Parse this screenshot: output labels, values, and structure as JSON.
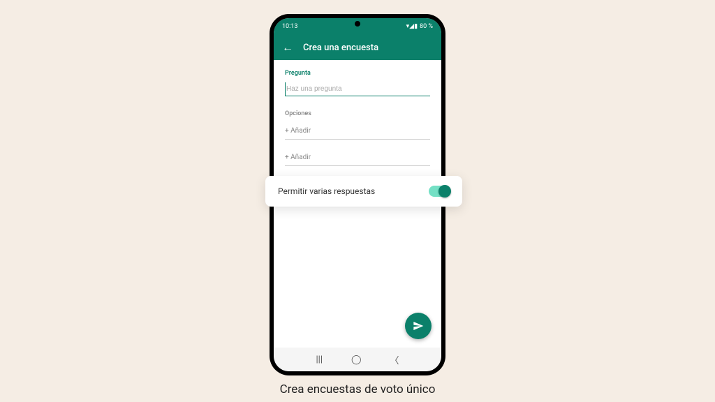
{
  "status": {
    "time": "10:13",
    "signal_icons": "▾◢▮",
    "battery": "80 %"
  },
  "header": {
    "title": "Crea una encuesta"
  },
  "form": {
    "question_label": "Pregunta",
    "question_placeholder": "Haz una pregunta",
    "options_label": "Opciones",
    "option_placeholder_1": "+ Añadir",
    "option_placeholder_2": "+ Añadir"
  },
  "toggle": {
    "label": "Permitir varias respuestas",
    "on": true
  },
  "caption": "Crea encuestas de voto único"
}
